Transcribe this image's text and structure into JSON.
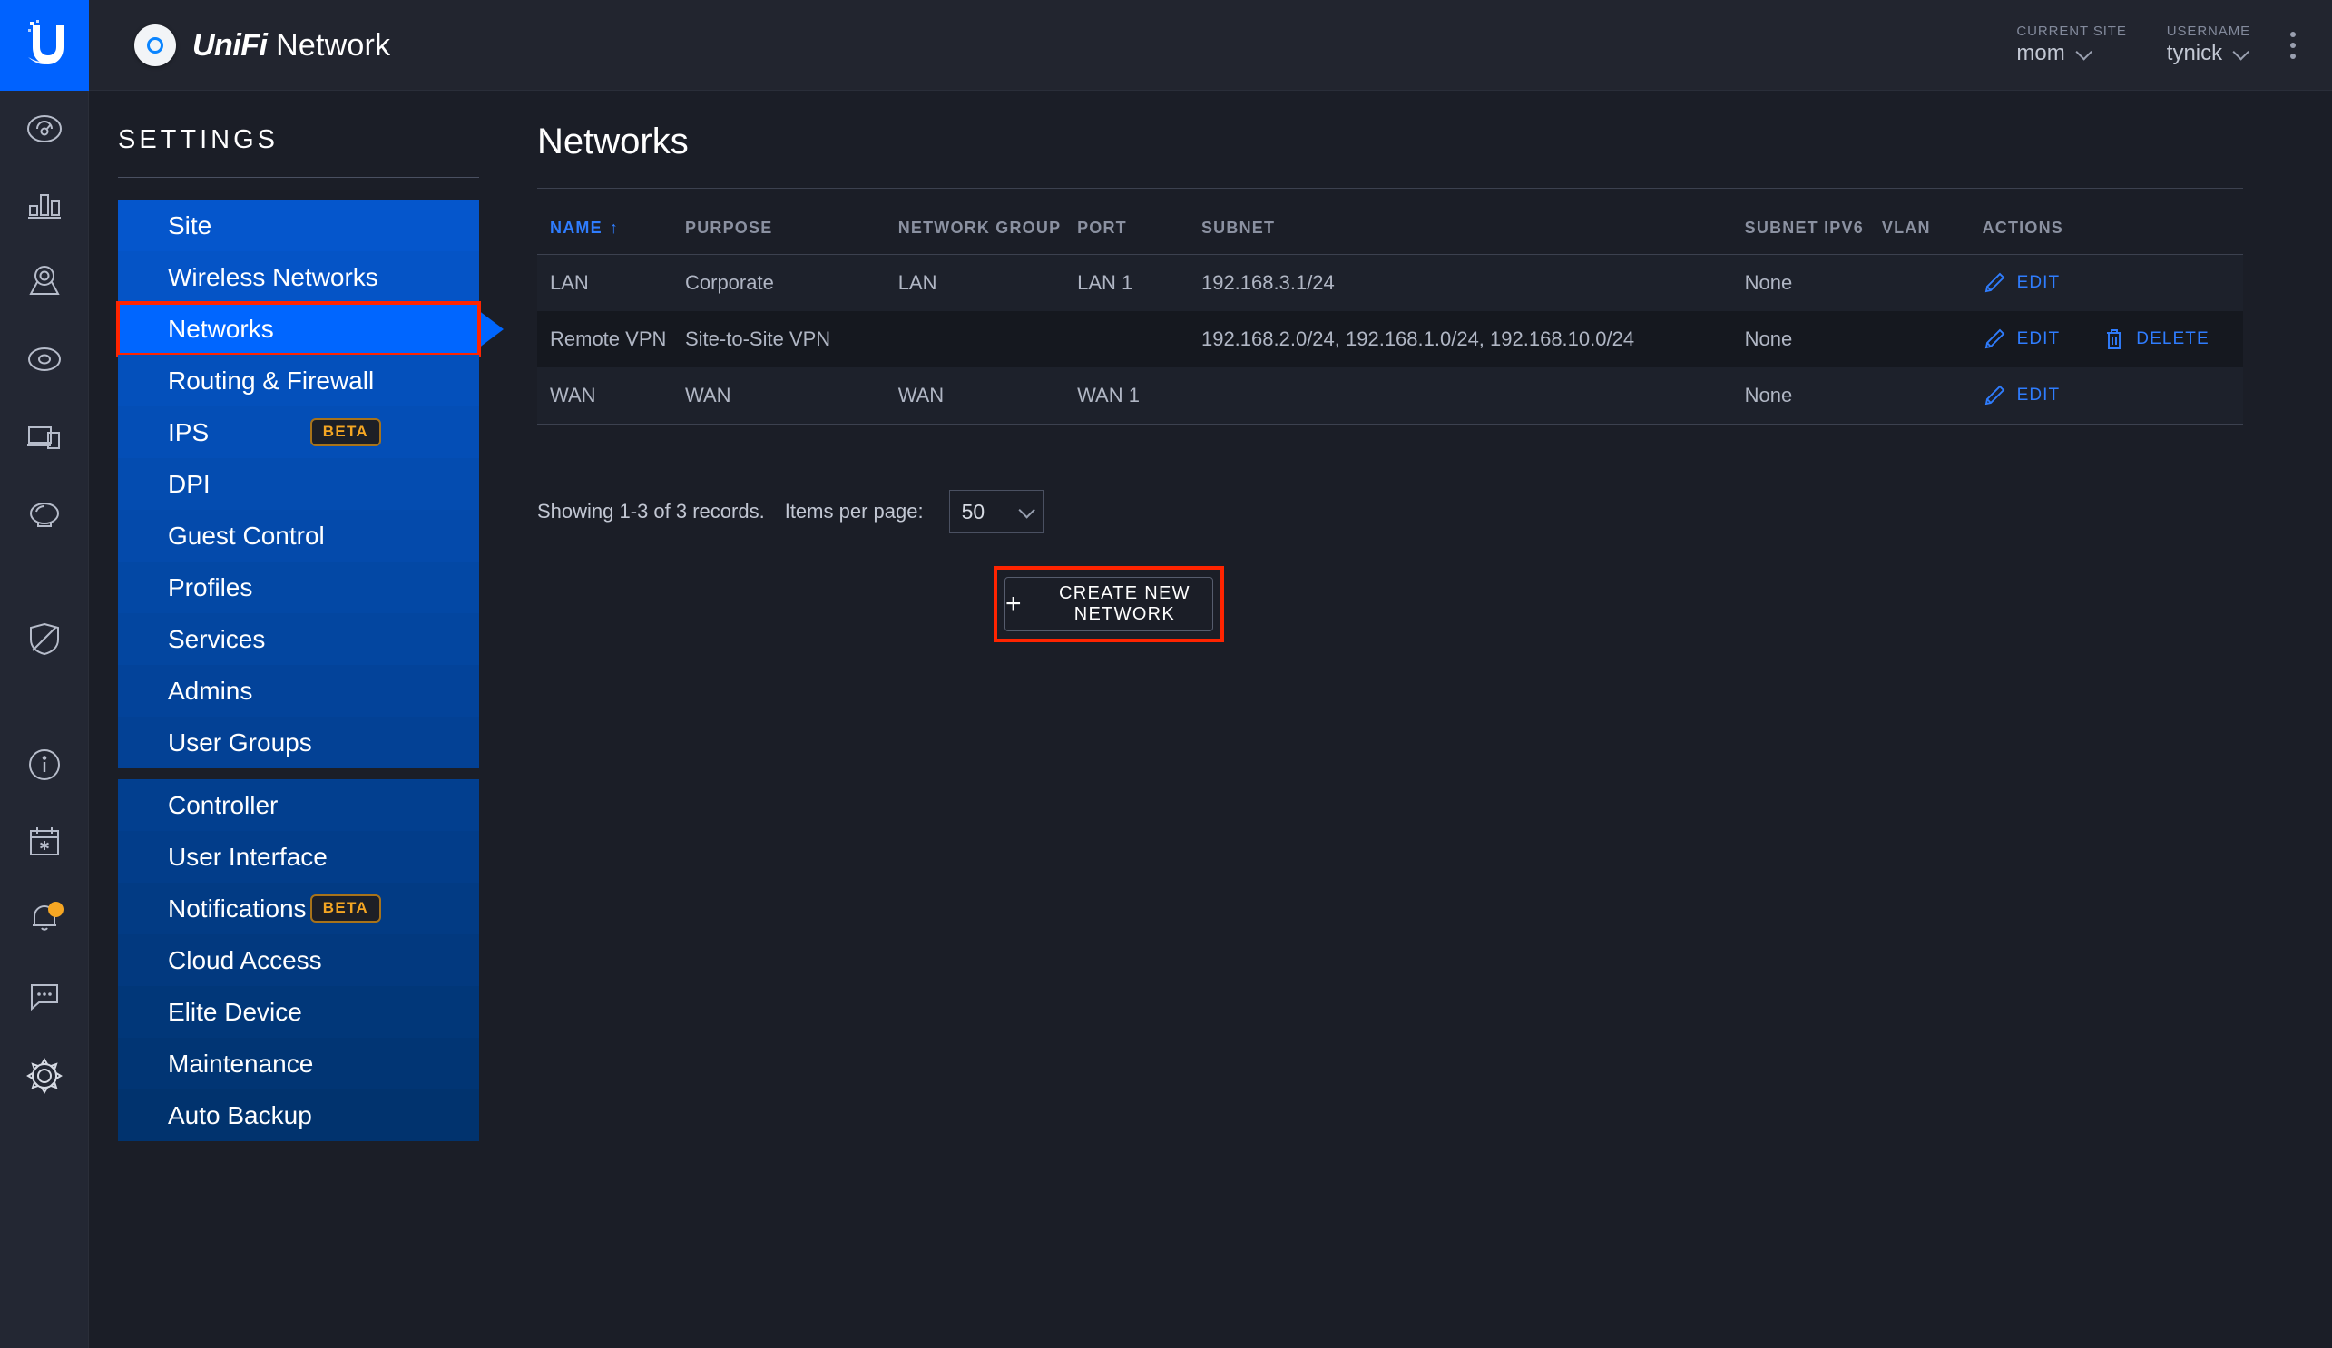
{
  "app": {
    "brand_unifi": "UniFi",
    "brand_product": "Network",
    "logo_icon": "ubiquiti-u-logo-icon",
    "ap_icon": "access-point-icon"
  },
  "topbar": {
    "current_site_label": "CURRENT SITE",
    "current_site_value": "mom",
    "username_label": "USERNAME",
    "username_value": "tynick",
    "kebab_icon": "more-vertical-icon"
  },
  "rail": {
    "items": [
      {
        "icon": "dashboard-gauge-icon"
      },
      {
        "icon": "statistics-bar-chart-icon"
      },
      {
        "icon": "map-pin-icon"
      },
      {
        "icon": "devices-access-point-icon"
      },
      {
        "icon": "clients-laptop-phone-icon"
      },
      {
        "icon": "insights-speech-icon"
      },
      {
        "icon": "divider"
      },
      {
        "icon": "shield-threat-management-icon"
      }
    ],
    "bottom_items": [
      {
        "icon": "info-circle-icon",
        "badge": false
      },
      {
        "icon": "calendar-star-icon",
        "badge": false
      },
      {
        "icon": "bell-notification-icon",
        "badge": true,
        "badge_color": "#f5a623"
      },
      {
        "icon": "chat-bubble-icon",
        "badge": false
      },
      {
        "icon": "gear-settings-icon",
        "badge": false
      }
    ]
  },
  "sidebar": {
    "title": "SETTINGS",
    "group1": [
      {
        "label": "Site",
        "badge": null,
        "active": false
      },
      {
        "label": "Wireless Networks",
        "badge": null,
        "active": false
      },
      {
        "label": "Networks",
        "badge": null,
        "active": true
      },
      {
        "label": "Routing & Firewall",
        "badge": null,
        "active": false
      },
      {
        "label": "IPS",
        "badge": "BETA",
        "active": false
      },
      {
        "label": "DPI",
        "badge": null,
        "active": false
      },
      {
        "label": "Guest Control",
        "badge": null,
        "active": false
      },
      {
        "label": "Profiles",
        "badge": null,
        "active": false
      },
      {
        "label": "Services",
        "badge": null,
        "active": false
      },
      {
        "label": "Admins",
        "badge": null,
        "active": false
      },
      {
        "label": "User Groups",
        "badge": null,
        "active": false
      }
    ],
    "group2": [
      {
        "label": "Controller",
        "badge": null,
        "active": false
      },
      {
        "label": "User Interface",
        "badge": null,
        "active": false
      },
      {
        "label": "Notifications",
        "badge": "BETA",
        "active": false
      },
      {
        "label": "Cloud Access",
        "badge": null,
        "active": false
      },
      {
        "label": "Elite Device",
        "badge": null,
        "active": false
      },
      {
        "label": "Maintenance",
        "badge": null,
        "active": false
      },
      {
        "label": "Auto Backup",
        "badge": null,
        "active": false
      }
    ]
  },
  "main": {
    "page_title": "Networks",
    "table": {
      "columns": [
        {
          "key": "name",
          "label": "NAME",
          "sorted": true,
          "sort_dir": "↑"
        },
        {
          "key": "purpose",
          "label": "PURPOSE",
          "sorted": false
        },
        {
          "key": "network_group",
          "label": "NETWORK GROUP",
          "sorted": false
        },
        {
          "key": "port",
          "label": "PORT",
          "sorted": false
        },
        {
          "key": "subnet",
          "label": "SUBNET",
          "sorted": false
        },
        {
          "key": "subnet_ipv6",
          "label": "SUBNET IPV6",
          "sorted": false
        },
        {
          "key": "vlan",
          "label": "VLAN",
          "sorted": false
        },
        {
          "key": "actions",
          "label": "ACTIONS",
          "sorted": false
        }
      ],
      "rows": [
        {
          "name": "LAN",
          "purpose": "Corporate",
          "network_group": "LAN",
          "port": "LAN 1",
          "subnet": "192.168.3.1/24",
          "subnet_ipv6": "None",
          "vlan": "",
          "actions": [
            "EDIT"
          ]
        },
        {
          "name": "Remote VPN",
          "purpose": "Site-to-Site VPN",
          "network_group": "",
          "port": "",
          "subnet": "192.168.2.0/24, 192.168.1.0/24, 192.168.10.0/24",
          "subnet_ipv6": "None",
          "vlan": "",
          "actions": [
            "EDIT",
            "DELETE"
          ]
        },
        {
          "name": "WAN",
          "purpose": "WAN",
          "network_group": "WAN",
          "port": "WAN 1",
          "subnet": "",
          "subnet_ipv6": "None",
          "vlan": "",
          "actions": [
            "EDIT"
          ]
        }
      ],
      "edit_label": "EDIT",
      "delete_label": "DELETE",
      "edit_icon": "pencil-edit-icon",
      "delete_icon": "trash-delete-icon"
    },
    "pagination": {
      "showing_text": "Showing 1-3 of 3 records.",
      "items_per_page_label": "Items per page:",
      "items_per_page_value": "50",
      "chevron_icon": "chevron-down-icon"
    },
    "create_button": {
      "label": "CREATE NEW NETWORK",
      "plus_icon": "plus-icon"
    }
  },
  "highlight": {
    "color": "#ff2400",
    "targets": [
      "sidebar-item-networks",
      "create-new-network-button"
    ]
  },
  "colors": {
    "accent_blue": "#0066ff",
    "link_blue": "#2f7dff",
    "badge_orange": "#f5a623",
    "page_bg": "#1b1e27"
  }
}
